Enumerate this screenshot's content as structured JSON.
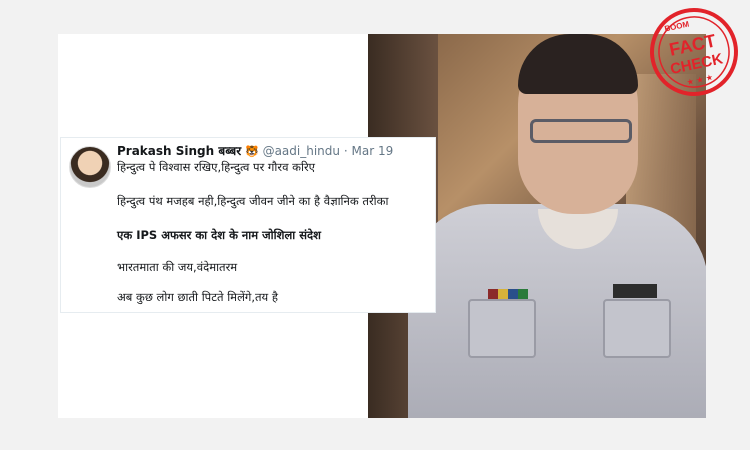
{
  "tweet": {
    "display_name": "Prakash Singh बब्बर",
    "emoji": "🐯",
    "handle": "@aadi_hindu",
    "separator": "·",
    "date": "Mar 19",
    "lines": [
      "हिन्दुत्व पे विश्वास रखिए,हिन्दुत्व पर गौरव करिए",
      "हिन्दुत्व पंथ मजहब नही,हिन्दुत्व जीवन जीने का है वैज्ञानिक तरीका",
      "एक IPS अफसर का देश के नाम जोशिला संदेश",
      "भारतमाता की जय,वंदेमातरम",
      "अब कुछ लोग छाती पिटते मिलेंगे,तय है"
    ]
  },
  "stamp": {
    "brand": "BOOM",
    "word1": "FACT",
    "word2": "CHECK",
    "stars": "★ ★ ★",
    "color": "#e2232a"
  },
  "colors": {
    "background": "#f2f2f2",
    "card": "#ffffff",
    "text": "#14171a",
    "muted": "#657786"
  }
}
